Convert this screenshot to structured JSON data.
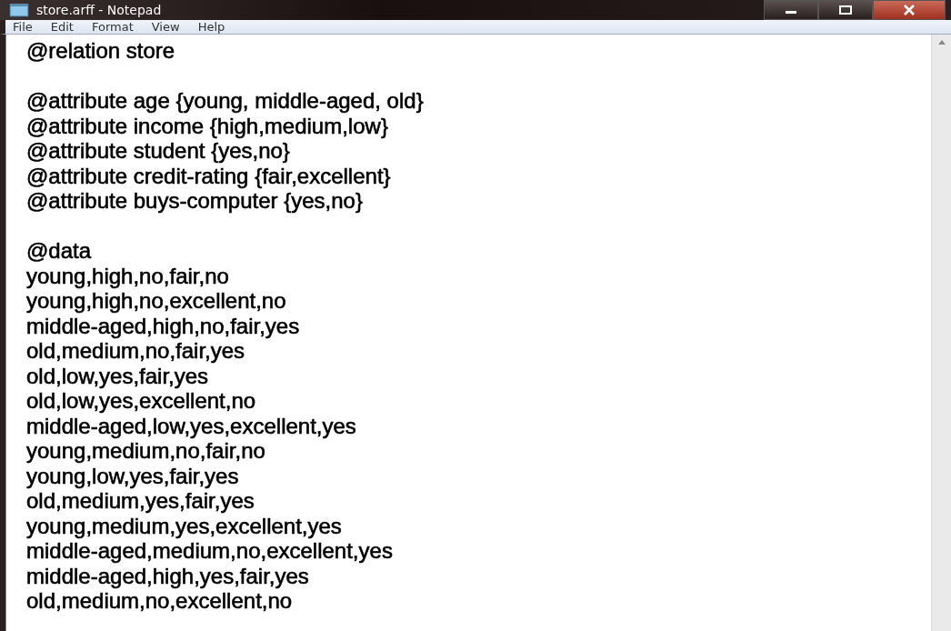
{
  "window": {
    "title": "store.arff - Notepad"
  },
  "menu": [
    "File",
    "Edit",
    "Format",
    "View",
    "Help"
  ],
  "document": {
    "blocks": [
      [
        "@relation store"
      ],
      [
        "@attribute age {young, middle-aged, old}",
        "@attribute income {high,medium,low}",
        "@attribute student {yes,no}",
        "@attribute credit-rating {fair,excellent}",
        "@attribute buys-computer {yes,no}"
      ],
      [
        "@data",
        "young,high,no,fair,no",
        "young,high,no,excellent,no",
        "middle-aged,high,no,fair,yes",
        "old,medium,no,fair,yes",
        "old,low,yes,fair,yes",
        "old,low,yes,excellent,no",
        "middle-aged,low,yes,excellent,yes",
        "young,medium,no,fair,no",
        "young,low,yes,fair,yes",
        "old,medium,yes,fair,yes",
        "young,medium,yes,excellent,yes",
        "middle-aged,medium,no,excellent,yes",
        "middle-aged,high,yes,fair,yes",
        "old,medium,no,excellent,no"
      ]
    ]
  }
}
